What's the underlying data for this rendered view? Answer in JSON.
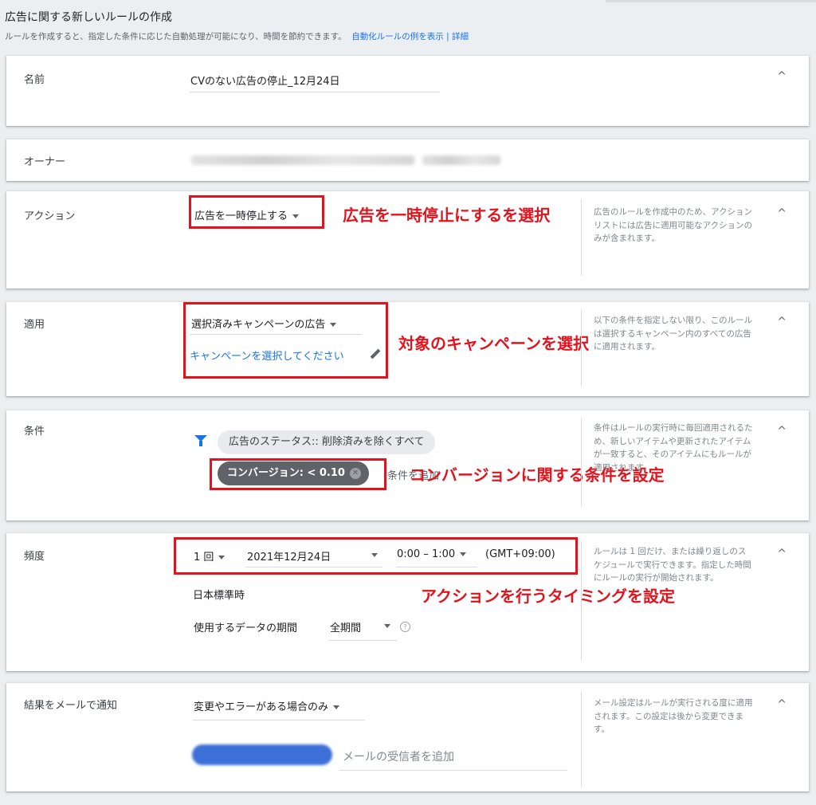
{
  "header": {
    "title": "広告に関する新しいルールの作成",
    "subtitle": "ルールを作成すると、指定した条件に応じた自動処理が可能になり、時間を節約できます。",
    "link_examples": "自動化ルールの例を表示",
    "separator": "|",
    "link_details": "詳細"
  },
  "name_section": {
    "label": "名前",
    "value": "CVのない広告の停止_12月24日",
    "chevron": "^"
  },
  "owner_section": {
    "label": "オーナー"
  },
  "action_section": {
    "label": "アクション",
    "dropdown_value": "広告を一時停止する",
    "help": "広告のルールを作成中のため、アクション リストには広告に適用可能なアクションのみが含まれます。",
    "annotation": "広告を一時停止にするを選択",
    "chevron": "^"
  },
  "apply_section": {
    "label": "適用",
    "dropdown_value": "選択済みキャンペーンの広告",
    "link_text": "キャンペーンを選択してください",
    "help": "以下の条件を指定しない限り、このルールは選択するキャンペーン内のすべての広告に適用されます。",
    "annotation": "対象のキャンペーンを選択",
    "chevron": "^"
  },
  "condition_section": {
    "label": "条件",
    "status_chip": "広告のステータス:: 削除済みを除くすべて",
    "conversion_chip": "コンバージョン: < 0.10",
    "add_condition": "条件を追加",
    "help": "条件はルールの実行時に毎回適用されるため、新しいアイテムや更新されたアイテムが一致すると、そのアイテムにもルールが適用されます。",
    "annotation": "コンバージョンに関する条件を設定",
    "chevron": "^"
  },
  "frequency_section": {
    "label": "頻度",
    "frequency_value": "1 回",
    "date_value": "2021年12月24日",
    "time_value": "0:00 – 1:00",
    "timezone_offset": "(GMT+09:00)",
    "timezone_name": "日本標準時",
    "data_period_label": "使用するデータの期間",
    "data_period_value": "全期間",
    "help_icon": "?",
    "help": "ルールは 1 回だけ、または繰り返しのスケジュールで実行できます。指定した時間にルールの実行が開始されます。",
    "annotation": "アクションを行うタイミングを設定",
    "chevron": "^"
  },
  "email_section": {
    "label": "結果をメールで通知",
    "dropdown_value": "変更やエラーがある場合のみ",
    "recipient_placeholder": "メールの受信者を追加",
    "help": "メール設定はルールが実行される度に適用されます。この設定は後から変更できます。",
    "chevron": "^"
  },
  "colors": {
    "accent": "#1a73e8",
    "annotation_red": "#e1141e",
    "chip_dark": "#5f6368"
  },
  "icons": [
    "chevron-up-icon",
    "dropdown-arrow-icon",
    "filter-icon",
    "remove-chip-icon",
    "pencil-icon",
    "help-circle-icon"
  ]
}
